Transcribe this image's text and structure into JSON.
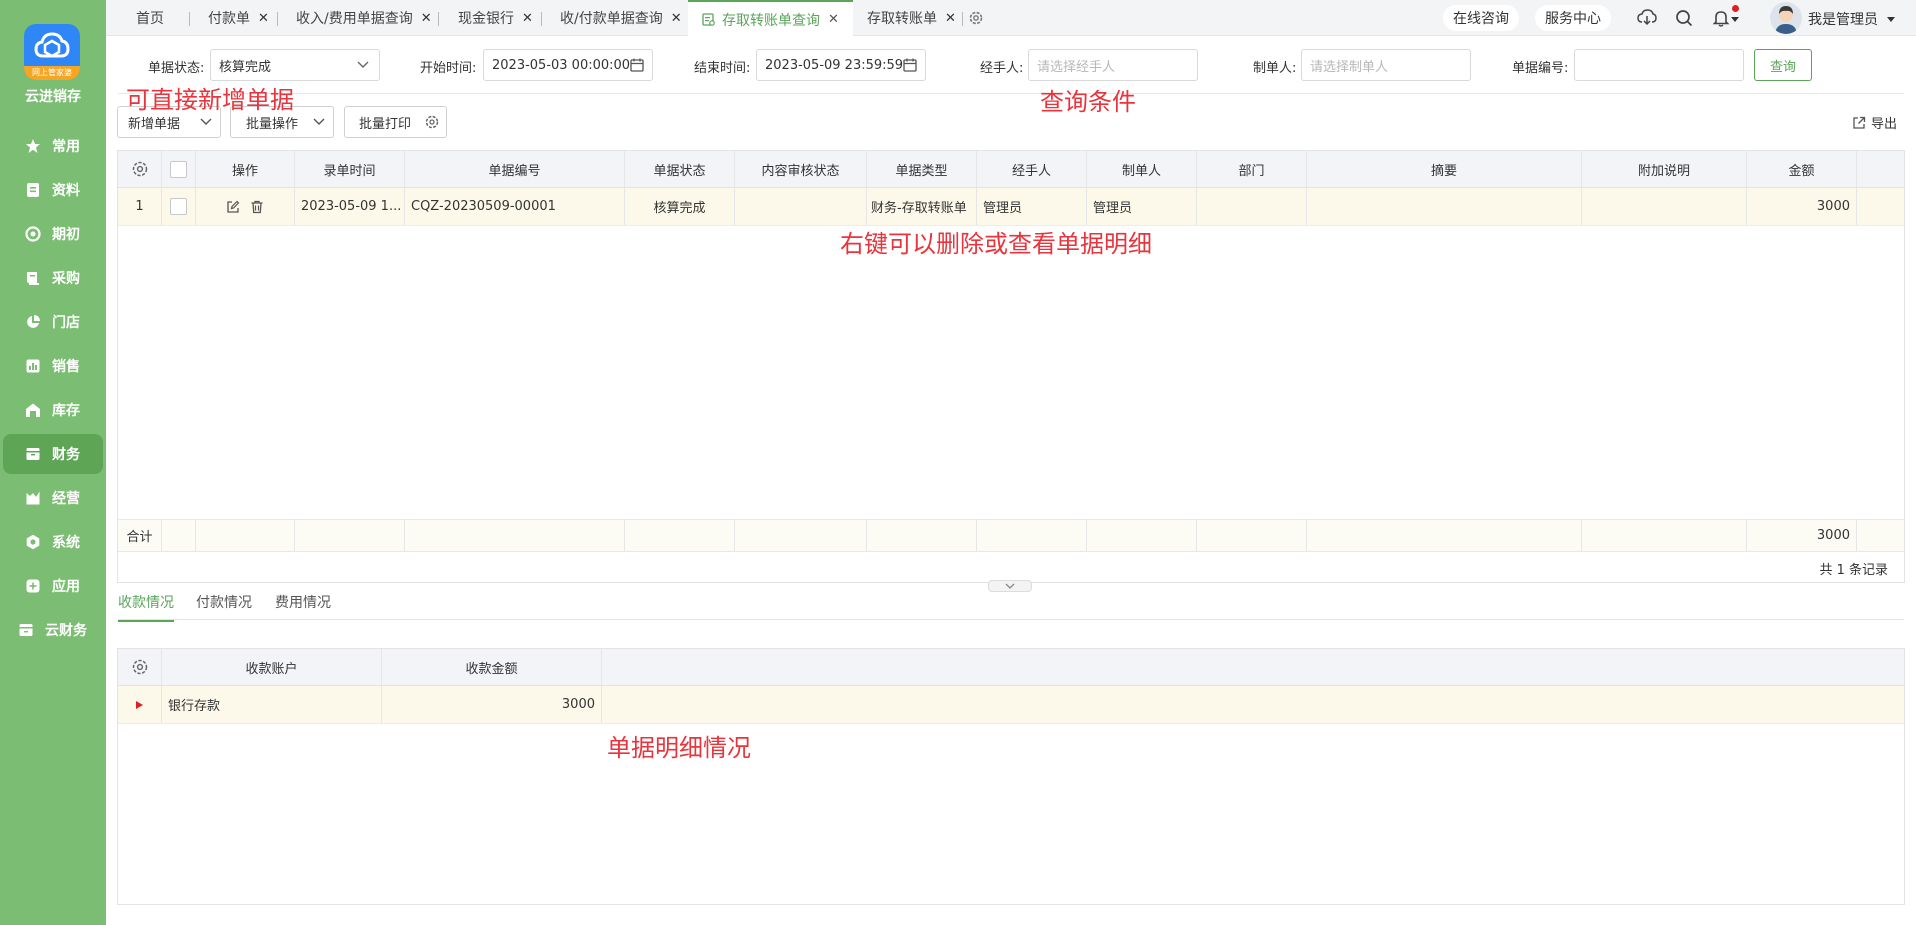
{
  "brand": {
    "name": "云进销存",
    "logo_ribbon": "网上管家婆"
  },
  "sidebar": {
    "items": [
      {
        "label": "常用",
        "icon": "star-icon"
      },
      {
        "label": "资料",
        "icon": "document-icon"
      },
      {
        "label": "期初",
        "icon": "target-icon"
      },
      {
        "label": "采购",
        "icon": "book-icon"
      },
      {
        "label": "门店",
        "icon": "pie-icon"
      },
      {
        "label": "销售",
        "icon": "bar-chart-icon"
      },
      {
        "label": "库存",
        "icon": "warehouse-icon"
      },
      {
        "label": "财务",
        "icon": "wallet-icon",
        "active": true
      },
      {
        "label": "经营",
        "icon": "trend-icon"
      },
      {
        "label": "系统",
        "icon": "hex-gear-icon"
      },
      {
        "label": "应用",
        "icon": "plus-square-icon"
      },
      {
        "label": "云财务",
        "icon": "cloud-wallet-icon"
      }
    ]
  },
  "tabs": {
    "home": "首页",
    "t1": "付款单",
    "t2": "收入/费用单据查询",
    "t3": "现金银行",
    "t4": "收/付款单据查询",
    "t5": "存取转账单查询",
    "t6": "存取转账单"
  },
  "topbar": {
    "consult": "在线咨询",
    "service": "服务中心",
    "user": "我是管理员"
  },
  "filters": {
    "status_label": "单据状态:",
    "status_value": "核算完成",
    "start_label": "开始时间:",
    "start_value": "2023-05-03 00:00:00",
    "end_label": "结束时间:",
    "end_value": "2023-05-09 23:59:59",
    "handler_label": "经手人:",
    "handler_placeholder": "请选择经手人",
    "maker_label": "制单人:",
    "maker_placeholder": "请选择制单人",
    "number_label": "单据编号:",
    "number_value": "",
    "query_button": "查询"
  },
  "toolbar": {
    "new": "新增单据",
    "batch": "批量操作",
    "print": "批量打印",
    "export": "导出"
  },
  "annotations": {
    "a1": "可直接新增单据",
    "a2": "查询条件",
    "a3": "右键可以删除或查看单据明细",
    "a4": "单据明细情况"
  },
  "grid": {
    "columns": [
      "操作",
      "录单时间",
      "单据编号",
      "单据状态",
      "内容审核状态",
      "单据类型",
      "经手人",
      "制单人",
      "部门",
      "摘要",
      "附加说明",
      "金额"
    ],
    "rows": [
      {
        "index": "1",
        "time": "2023-05-09 1...",
        "number": "CQZ-20230509-00001",
        "status": "核算完成",
        "review": "",
        "type": "财务-存取转账单",
        "handler": "管理员",
        "maker": "管理员",
        "dept": "",
        "summary": "",
        "note": "",
        "amount": "3000"
      }
    ],
    "sum_label": "合计",
    "sum_amount": "3000",
    "record_count": "共 1 条记录"
  },
  "subtabs": {
    "s1": "收款情况",
    "s2": "付款情况",
    "s3": "费用情况"
  },
  "detail": {
    "columns": [
      "收款账户",
      "收款金额"
    ],
    "rows": [
      {
        "account": "银行存款",
        "amount": "3000"
      }
    ]
  },
  "colors": {
    "accent": "#5aa55a",
    "sidebar": "#7cbd74",
    "annotation": "#e8343c"
  }
}
